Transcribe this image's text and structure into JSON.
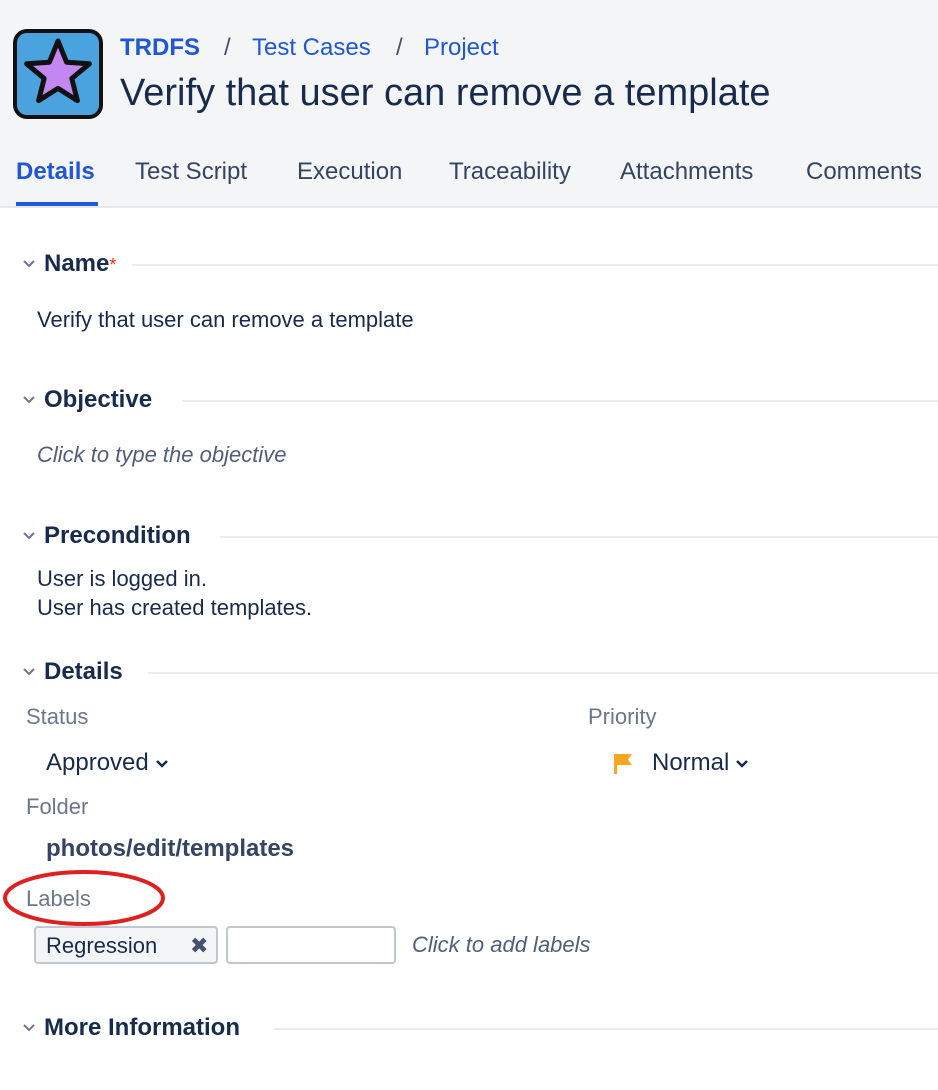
{
  "header": {
    "breadcrumb": [
      "TRDFS",
      "Test Cases",
      "Project"
    ],
    "separator": "/",
    "title": "Verify that user can remove a template"
  },
  "tabs": [
    {
      "label": "Details",
      "active": true
    },
    {
      "label": "Test Script"
    },
    {
      "label": "Execution"
    },
    {
      "label": "Traceability"
    },
    {
      "label": "Attachments"
    },
    {
      "label": "Comments"
    }
  ],
  "sections": {
    "name": {
      "title": "Name",
      "required_mark": "*",
      "value": "Verify that user can remove a template"
    },
    "objective": {
      "title": "Objective",
      "placeholder": "Click to type the objective"
    },
    "precondition": {
      "title": "Precondition",
      "lines": [
        "User is logged in.",
        "User has created templates."
      ]
    },
    "details": {
      "title": "Details",
      "status": {
        "label": "Status",
        "value": "Approved"
      },
      "priority": {
        "label": "Priority",
        "value": "Normal",
        "flag_color": "#f6a623"
      },
      "folder": {
        "label": "Folder",
        "value": "photos/edit/templates"
      },
      "labels": {
        "label": "Labels",
        "items": [
          "Regression"
        ],
        "placeholder": "Click to add labels",
        "remove_glyph": "✖"
      }
    },
    "more_info": {
      "title": "More Information"
    }
  },
  "colors": {
    "accent": "#1f57d6",
    "annotation": "#e02020"
  },
  "icons": {
    "project": "star-icon",
    "collapse": "chevron-down-icon",
    "priority": "flag-icon",
    "remove": "close-icon"
  }
}
